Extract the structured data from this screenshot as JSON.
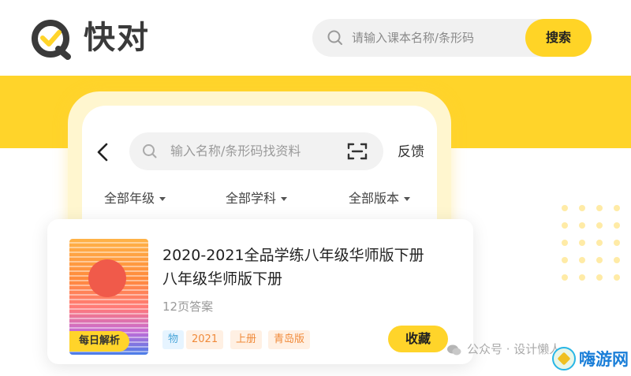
{
  "header": {
    "logo_text": "快对",
    "search": {
      "placeholder": "请输入课本名称/条形码",
      "button_label": "搜索"
    }
  },
  "phone": {
    "search_placeholder": "输入名称/条形码找资料",
    "feedback_label": "反馈",
    "filters": [
      "全部年级",
      "全部学科",
      "全部版本"
    ]
  },
  "book": {
    "cover_tag": "每日解析",
    "title_line1": "2020-2021全品学练八年级华师版下册",
    "title_line2": "八年级华师版下册",
    "pages": "12页答案",
    "chips": [
      "物",
      "2021",
      "上册",
      "青岛版"
    ],
    "collect_label": "收藏"
  },
  "watermark": {
    "text": "公众号 · 设计懒人",
    "site_name": "嗨游网"
  },
  "colors": {
    "brand_yellow": "#ffd42a",
    "logo_gray": "#3a3a3a",
    "chip_blue": "#4aa6d9",
    "chip_orange": "#f08a3a",
    "site_blue": "#1a7ed8"
  },
  "icons": [
    "logo-check-icon",
    "search-icon",
    "back-arrow-icon",
    "scan-icon",
    "caret-down-icon",
    "wechat-icon",
    "site-emblem-icon"
  ]
}
